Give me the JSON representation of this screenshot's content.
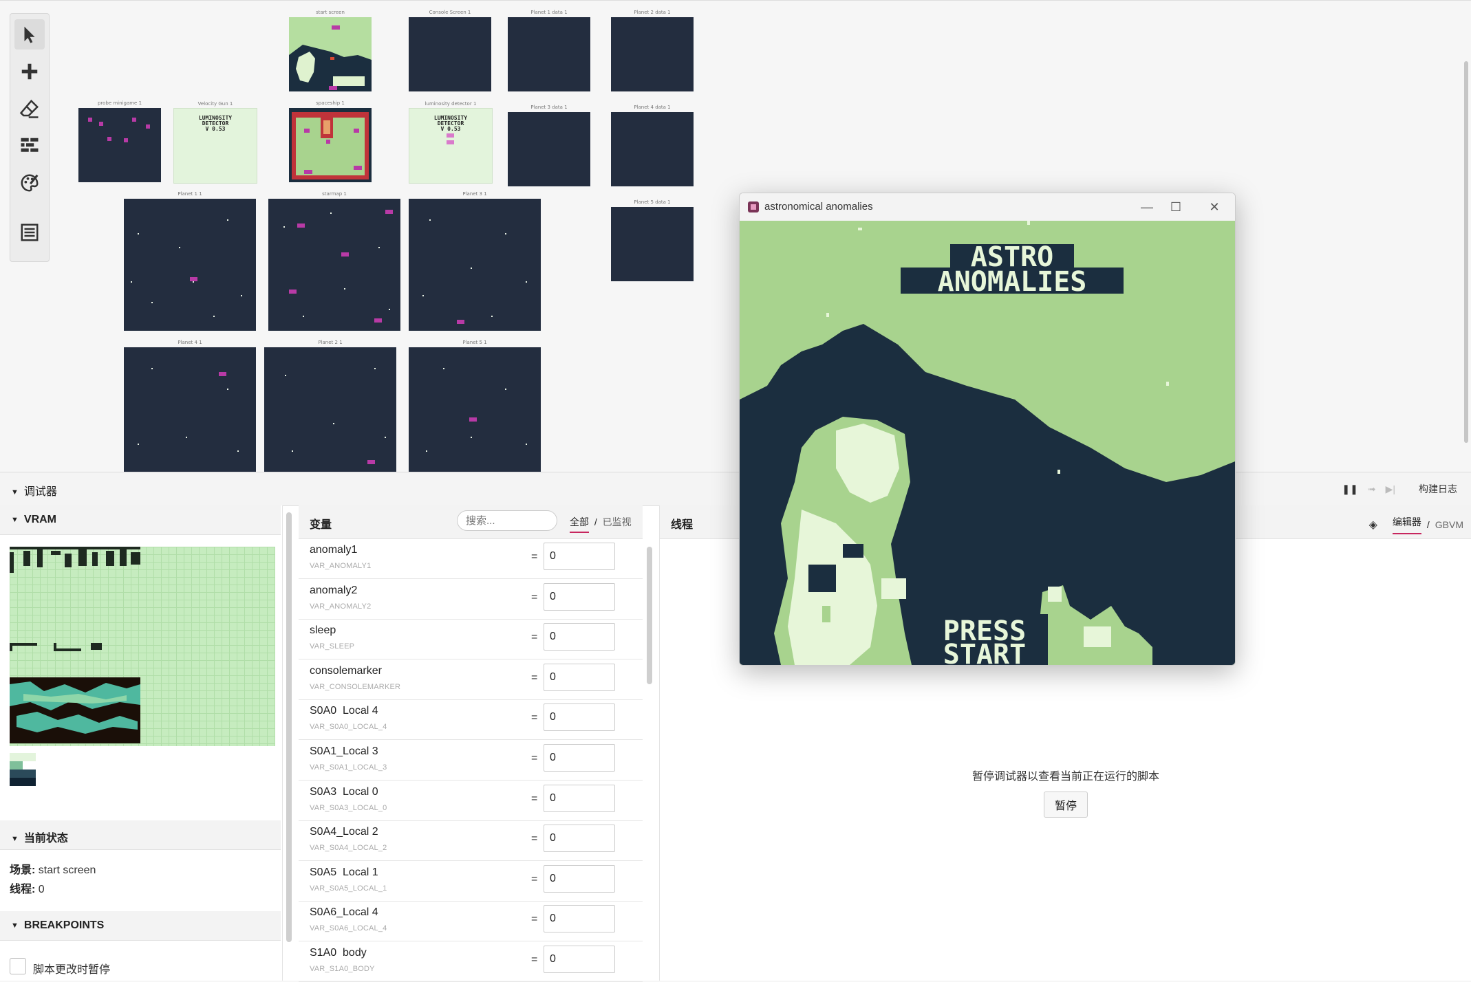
{
  "world": {
    "scenes": [
      {
        "id": "start",
        "label": "start screen"
      },
      {
        "id": "console",
        "label": "Console Screen 1"
      },
      {
        "id": "p1data",
        "label": "Planet 1 data 1"
      },
      {
        "id": "p2data",
        "label": "Planet 2 data 1"
      },
      {
        "id": "probe",
        "label": "probe minigame 1"
      },
      {
        "id": "velocity",
        "label": "Velocity Gun 1",
        "text": "LUMINOSITY\nDETECTOR\nV 0.53"
      },
      {
        "id": "ship",
        "label": "spaceship 1"
      },
      {
        "id": "lumdet",
        "label": "luminosity detector 1",
        "text": "LUMINOSITY\nDETECTOR\nV 0.53"
      },
      {
        "id": "p3data",
        "label": "Planet 3 data 1"
      },
      {
        "id": "p4data",
        "label": "Planet 4 data 1"
      },
      {
        "id": "planet1",
        "label": "Planet 1 1"
      },
      {
        "id": "starmap",
        "label": "starmap 1"
      },
      {
        "id": "planet3",
        "label": "Planet 3 1"
      },
      {
        "id": "p5data",
        "label": "Planet 5 data 1"
      },
      {
        "id": "planet4",
        "label": "Planet 4 1"
      },
      {
        "id": "planet2",
        "label": "Planet 2 1"
      },
      {
        "id": "planet5",
        "label": "Planet 5 1"
      }
    ]
  },
  "toolbar": {
    "tools": [
      {
        "icon": "select-cursor-icon",
        "active": true
      },
      {
        "icon": "add-plus-icon",
        "active": false
      },
      {
        "icon": "eraser-icon",
        "active": false
      },
      {
        "icon": "collisions-brick-icon",
        "active": false
      },
      {
        "icon": "paint-palette-icon",
        "active": false
      },
      {
        "icon": "script-list-icon",
        "active": false
      }
    ]
  },
  "debugger": {
    "title": "调试器",
    "build_log": "构建日志",
    "vram": {
      "title": "VRAM",
      "palette": [
        "#e3f4dc",
        "#7fbf9a",
        "#2b4a5a",
        "#0f2232"
      ]
    },
    "current_state": {
      "title": "当前状态",
      "scene_label": "场景:",
      "scene_value": "start screen",
      "thread_label": "线程:",
      "thread_value": "0"
    },
    "breakpoints": {
      "title": "BREAKPOINTS",
      "pause_on_change_label": "脚本更改时暂停"
    },
    "variables": {
      "title": "变量",
      "search_placeholder": "搜索...",
      "tab_all": "全部",
      "tab_watched": "已监视",
      "items": [
        {
          "name": "anomaly1",
          "id": "VAR_ANOMALY1",
          "value": "0"
        },
        {
          "name": "anomaly2",
          "id": "VAR_ANOMALY2",
          "value": "0"
        },
        {
          "name": "sleep",
          "id": "VAR_SLEEP",
          "value": "0"
        },
        {
          "name": "consolemarker",
          "id": "VAR_CONSOLEMARKER",
          "value": "0"
        },
        {
          "name": "S0A0  Local 4",
          "id": "VAR_S0A0_LOCAL_4",
          "value": "0"
        },
        {
          "name": "S0A1_Local 3",
          "id": "VAR_S0A1_LOCAL_3",
          "value": "0"
        },
        {
          "name": "S0A3  Local 0",
          "id": "VAR_S0A3_LOCAL_0",
          "value": "0"
        },
        {
          "name": "S0A4_Local 2",
          "id": "VAR_S0A4_LOCAL_2",
          "value": "0"
        },
        {
          "name": "S0A5  Local 1",
          "id": "VAR_S0A5_LOCAL_1",
          "value": "0"
        },
        {
          "name": "S0A6_Local 4",
          "id": "VAR_S0A6_LOCAL_4",
          "value": "0"
        },
        {
          "name": "S1A0  body",
          "id": "VAR_S1A0_BODY",
          "value": "0"
        }
      ]
    },
    "threads": {
      "title": "线程",
      "tab_editor": "编辑器",
      "tab_gbvm": "GBVM",
      "pause_message": "暂停调试器以查看当前正在运行的脚本",
      "pause_button": "暂停"
    }
  },
  "game_window": {
    "title": "astronomical anomalies",
    "screen_title_line1": "ASTRO",
    "screen_title_line2": "ANOMALIES",
    "press_line1": "PRESS",
    "press_line2": "START",
    "colors": {
      "sky": "#a8d38e",
      "dark": "#1b2e3f",
      "mid": "#8fcf7d",
      "light": "#e7f6d9"
    }
  }
}
